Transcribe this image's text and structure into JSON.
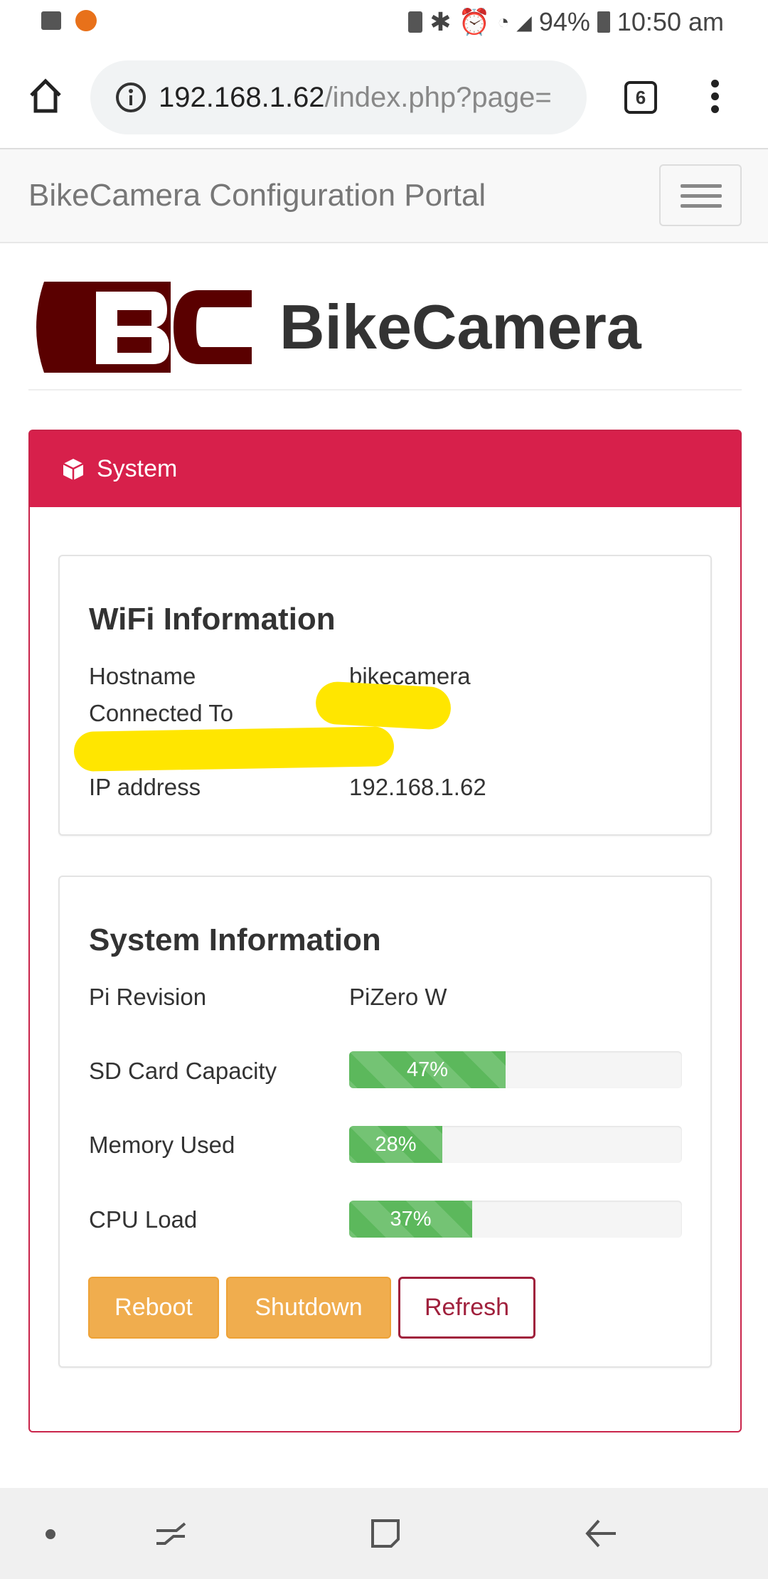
{
  "status_bar": {
    "battery": "94%",
    "time": "10:50 am"
  },
  "browser": {
    "url_host": "192.168.1.62",
    "url_path": "/index.php?page=",
    "tab_count": "6"
  },
  "navbar": {
    "title": "BikeCamera Configuration Portal"
  },
  "brand": {
    "logo_text": "BC",
    "name": "BikeCamera"
  },
  "panel": {
    "title": "System"
  },
  "wifi": {
    "title": "WiFi Information",
    "rows": [
      {
        "label": "Hostname",
        "value": "bikecamera"
      },
      {
        "label": "Connected To",
        "value": ""
      },
      {
        "label": "IP address",
        "value": "192.168.1.62"
      }
    ]
  },
  "system": {
    "title": "System Information",
    "pi_label": "Pi Revision",
    "pi_value": "PiZero W",
    "bars": [
      {
        "label": "SD Card Capacity",
        "percent": 47,
        "text": "47%"
      },
      {
        "label": "Memory Used",
        "percent": 28,
        "text": "28%"
      },
      {
        "label": "CPU Load",
        "percent": 37,
        "text": "37%"
      }
    ],
    "buttons": {
      "reboot": "Reboot",
      "shutdown": "Shutdown",
      "refresh": "Refresh"
    }
  },
  "colors": {
    "panel": "#d7204b",
    "progress": "#5cb85c",
    "warning": "#f0ad4e",
    "logo": "#5a0000"
  }
}
